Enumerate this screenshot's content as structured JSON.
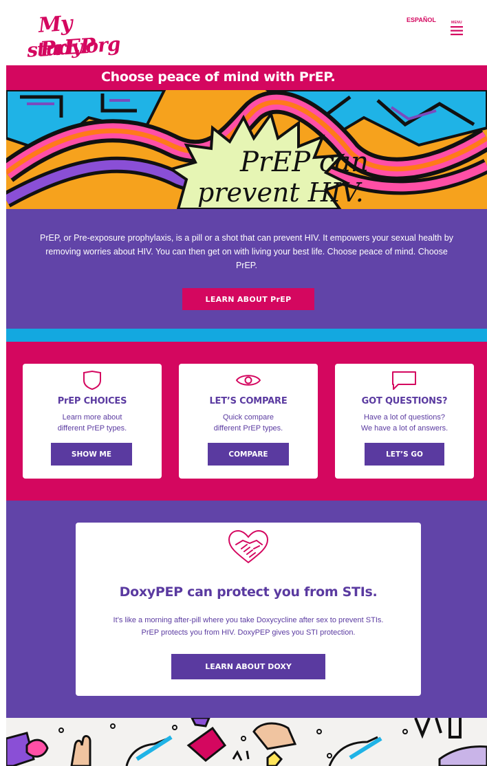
{
  "header": {
    "logo_line1": "My PrEP",
    "logo_line2": "study.org",
    "language_link": "ESPAÑOL",
    "menu_label": "MENU"
  },
  "tagline": "Choose peace of mind with PrEP.",
  "hero": {
    "text_line1": "PrEP can",
    "text_line2": "prevent HIV."
  },
  "intro": {
    "paragraph": "PrEP, or Pre-exposure prophylaxis, is a pill or a shot that can prevent HIV. It empowers your sexual health by removing worries about HIV. You can then get on with living your best life. Choose peace of mind. Choose PrEP.",
    "button_label": "LEARN ABOUT PrEP"
  },
  "cards": [
    {
      "icon": "shield-icon",
      "title": "PrEP CHOICES",
      "desc_line1": "Learn more about",
      "desc_line2": "different PrEP types.",
      "button_label": "SHOW ME"
    },
    {
      "icon": "eye-icon",
      "title": "LET’S COMPARE",
      "desc_line1": "Quick compare",
      "desc_line2": "different PrEP types.",
      "button_label": "COMPARE"
    },
    {
      "icon": "chat-bubble-icon",
      "title": "GOT QUESTIONS?",
      "desc_line1": "Have a lot of questions?",
      "desc_line2": "We have a lot of answers.",
      "button_label": "LET’S GO"
    }
  ],
  "doxy": {
    "icon": "handshake-heart-icon",
    "title": "DoxyPEP can protect you from STIs.",
    "desc_line1": "It’s like a morning after-pill where you take Doxycycline after sex to prevent STIs.",
    "desc_line2": "PrEP protects you from HIV. DoxyPEP gives you STI protection.",
    "button_label": "LEARN ABOUT DOXY"
  },
  "colors": {
    "brand_pink": "#d4075f",
    "brand_purple": "#6144a8",
    "button_purple": "#5a3aa0",
    "accent_blue": "#13a8e0",
    "hero_orange": "#f6a21d",
    "starburst_green": "#e6f5b4"
  }
}
